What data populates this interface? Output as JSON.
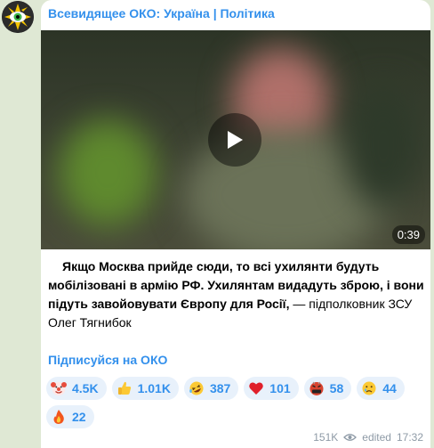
{
  "channel": {
    "name": "Всевидящее ОКО: Україна | Політика"
  },
  "video": {
    "duration": "0:39"
  },
  "message": {
    "quote": "Якщо Москва прийде сюди, то всі ухилянти будуть мобілізовані в армію РФ. Ухилянтам видадуть зброю, і вони підуть завойовувати Європу для Росії,",
    "attribution": " — підполковник ЗСУ Олег Тягнибок"
  },
  "subscribe_link": "Підписуйся на ОКО",
  "reactions": [
    {
      "icon": "clown-face-icon",
      "count": "4.5K"
    },
    {
      "icon": "thumbs-up-icon",
      "count": "1.01K"
    },
    {
      "icon": "rolling-laughing-icon",
      "count": "387"
    },
    {
      "icon": "red-heart-icon",
      "count": "101"
    },
    {
      "icon": "cursing-face-icon",
      "count": "58"
    },
    {
      "icon": "crying-face-icon",
      "count": "44"
    },
    {
      "icon": "fire-icon",
      "count": "22"
    }
  ],
  "meta": {
    "views": "151K",
    "edited_label": "edited",
    "time": "17:32"
  },
  "colors": {
    "accent": "#3390ec",
    "background": "#dfe8d4",
    "reaction_bg": "#e8f1fb"
  }
}
